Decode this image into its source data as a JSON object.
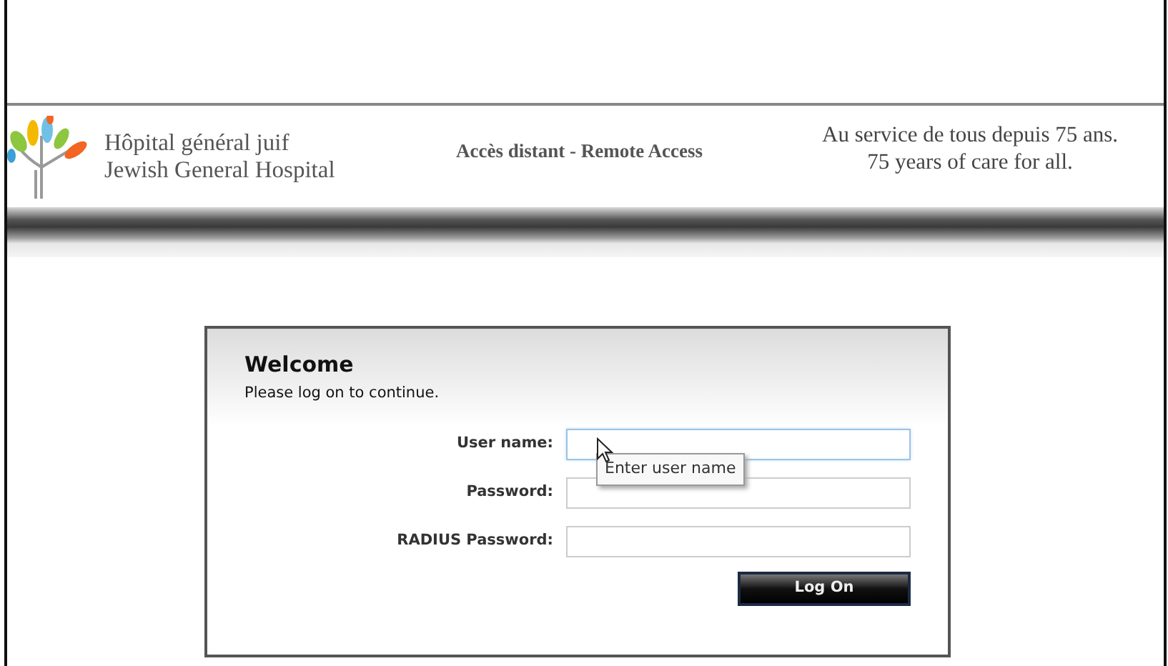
{
  "header": {
    "hospital_name_fr": "Hôpital général juif",
    "hospital_name_en": "Jewish General Hospital",
    "title": "Accès distant - Remote Access",
    "slogan_fr": "Au service de tous depuis 75 ans.",
    "slogan_en": "75 years of care for all."
  },
  "login": {
    "heading": "Welcome",
    "instruction": "Please log on to continue.",
    "fields": [
      {
        "label": "User name:",
        "focused": true
      },
      {
        "label": "Password:",
        "focused": false
      },
      {
        "label": "RADIUS Password:",
        "focused": false
      }
    ],
    "tooltip": "Enter user name",
    "button": "Log On"
  }
}
